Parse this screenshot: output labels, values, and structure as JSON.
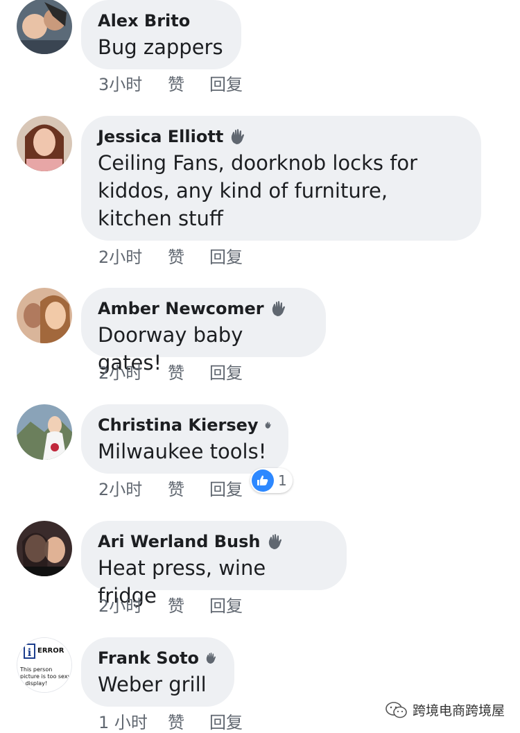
{
  "comments": [
    {
      "name": "Alex Brito",
      "text": "Bug zappers",
      "time": "3小时",
      "like": "赞",
      "reply": "回复",
      "has_wave": false
    },
    {
      "name": "Jessica Elliott",
      "text": "Ceiling Fans, doorknob locks for kiddos, any kind of furniture, kitchen stuff",
      "time": "2小时",
      "like": "赞",
      "reply": "回复",
      "has_wave": true
    },
    {
      "name": "Amber Newcomer",
      "text": "Doorway baby gates!",
      "time": "2小时",
      "like": "赞",
      "reply": "回复",
      "has_wave": true
    },
    {
      "name": "Christina Kiersey",
      "text": "Milwaukee tools!",
      "time": "2小时",
      "like": "赞",
      "reply": "回复",
      "has_wave": true,
      "reaction": {
        "icon": "thumbs-up-icon",
        "count": "1",
        "color": "#2d88ff"
      }
    },
    {
      "name": "Ari Werland Bush",
      "text": "Heat press, wine fridge",
      "time": "2小时",
      "like": "赞",
      "reply": "回复",
      "has_wave": true
    },
    {
      "name": "Frank Soto",
      "text": "Weber grill",
      "time": "1 小时",
      "like": "赞",
      "reply": "回复",
      "has_wave": true,
      "avatar_text": {
        "title": "ERROR",
        "line1": "This person",
        "line2": "picture is too sexy",
        "line3": "o display!"
      }
    }
  ],
  "watermark": {
    "text": "跨境电商跨境屋",
    "icon": "wechat-icon"
  },
  "colors": {
    "bubble": "#eef0f3",
    "meta": "#606770",
    "like_blue": "#2d88ff"
  }
}
